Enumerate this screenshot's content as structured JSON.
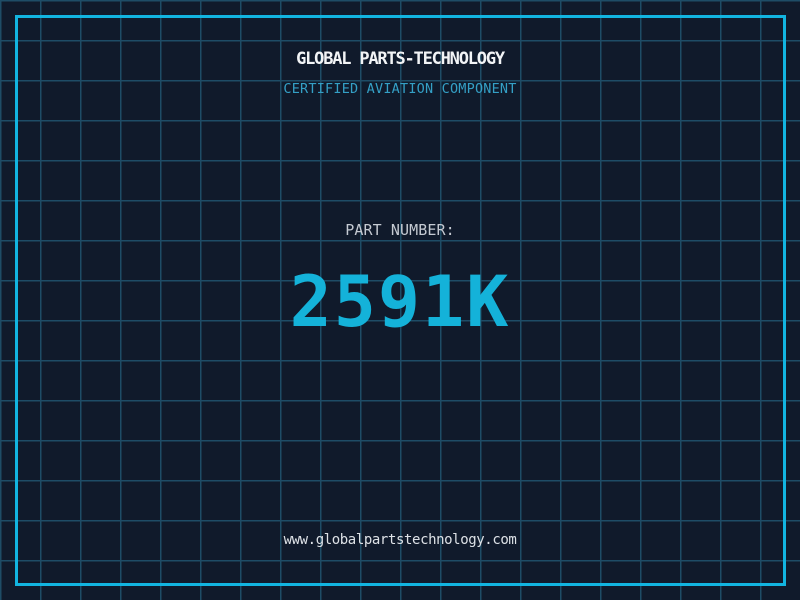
{
  "header": {
    "title": "GLOBAL PARTS-TECHNOLOGY",
    "subtitle": "CERTIFIED AVIATION COMPONENT"
  },
  "part": {
    "label": "PART NUMBER:",
    "number": "2591K"
  },
  "footer": {
    "website": "www.globalpartstechnology.com"
  },
  "colors": {
    "background": "#101a2b",
    "grid_line": "#1e4c66",
    "frame_border": "#12b4e0",
    "title_text": "#f2f4f6",
    "subtitle_text": "#34a0c6",
    "part_label_text": "#c5cad2",
    "part_number_text": "#14b2d9",
    "website_text": "#dde1e6"
  }
}
